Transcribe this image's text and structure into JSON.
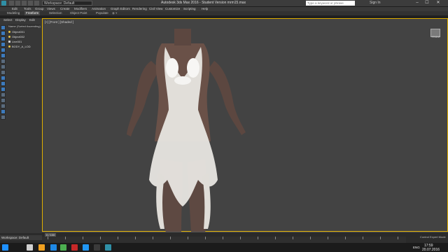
{
  "window": {
    "workspace": "Workspace: Default",
    "title": "Autodesk 3ds Max 2016 - Student Version   mrm15.max",
    "search_placeholder": "Type a keyword or phrase",
    "sign_in": "Sign In",
    "controls": [
      "–",
      "☐",
      "✕"
    ]
  },
  "menubar": [
    "Edit",
    "Tools",
    "Group",
    "Views",
    "Create",
    "Modifiers",
    "Animation",
    "Graph Editors",
    "Rendering",
    "Civil View",
    "Customize",
    "Scripting",
    "Help"
  ],
  "ribbon": {
    "tabs": [
      "Modeling",
      "Freeform",
      "Selection",
      "Object Paint",
      "Populate"
    ],
    "active": "Freeform"
  },
  "explorer": {
    "tabs": [
      "Select",
      "Display",
      "Edit"
    ],
    "header": "Name (Sorted Ascending)",
    "items": [
      {
        "label": "Object001",
        "icon": "light"
      },
      {
        "label": "Object002",
        "icon": "light"
      },
      {
        "label": "Line001",
        "icon": "object"
      },
      {
        "label": "BODY_A_LOD",
        "icon": "light"
      }
    ]
  },
  "viewport": {
    "label": "[+] [Front ] [Shaded ]",
    "viewcube_label": "FRONT",
    "model": "female figure wearing white ornate dress"
  },
  "timeline": {
    "slider": "0 / 100",
    "workspace_footer": "Workspace: Default",
    "control_label": "Control Expert Mode"
  },
  "taskbar": {
    "language": "ENG",
    "time": "17:59",
    "date": "20.07.2016"
  },
  "colors": {
    "viewport_bg": "#434343",
    "viewport_border": "#e0b000",
    "accent": "#3d7bbd"
  }
}
